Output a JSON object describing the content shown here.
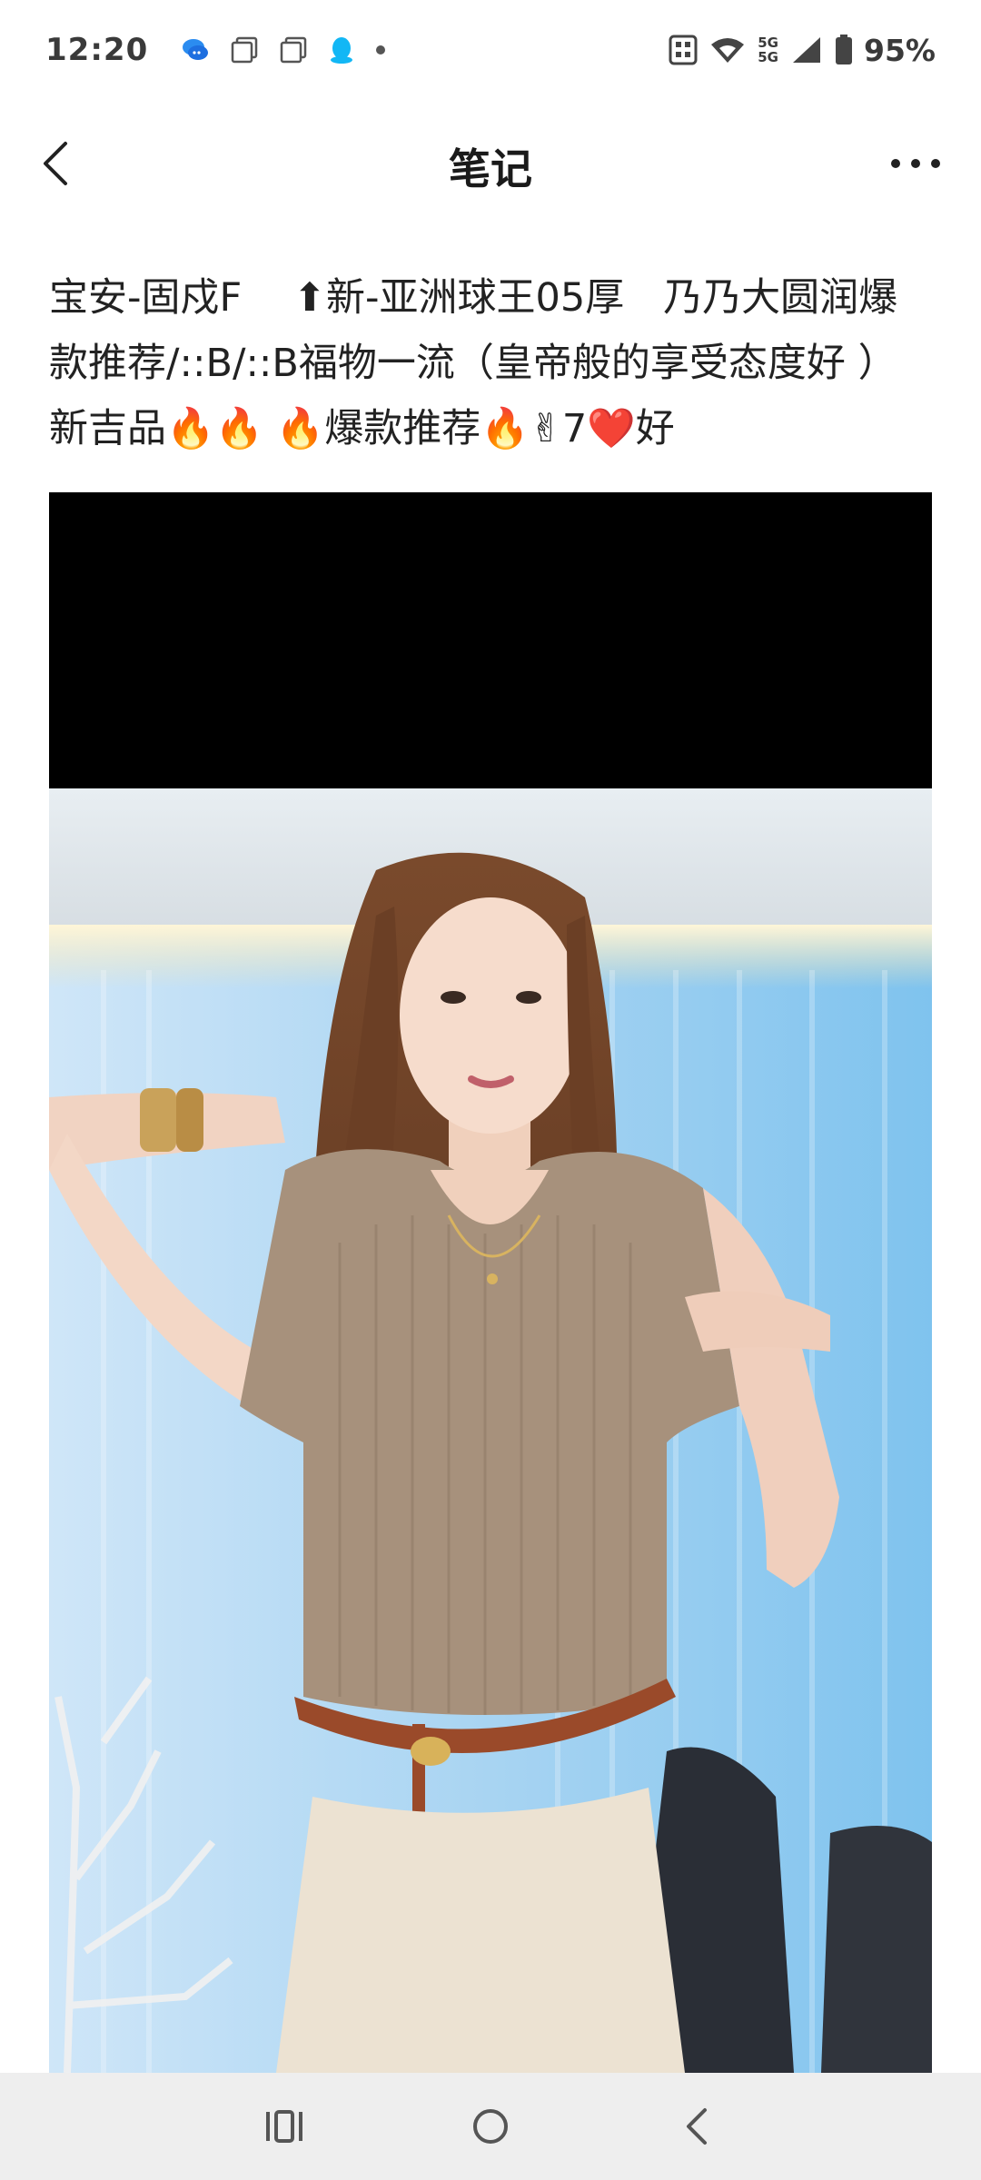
{
  "status_bar": {
    "time": "12:20",
    "battery": "95%",
    "network_top": "5G",
    "network_bottom": "5G"
  },
  "header": {
    "title": "笔记"
  },
  "note": {
    "text": "宝安-固戍F　 ⬆新-亚洲球王05厚　乃乃大圆润爆款推荐/::B/::B福物一流（皇帝般的享受态度好 ）新吉品🔥🔥 🔥爆款推荐🔥✌7❤️好"
  },
  "colors": {
    "background": "#ffffff",
    "nav_bar": "#eeeeee",
    "text": "#222222"
  },
  "icons": {
    "back": "chevron-left-icon",
    "more": "more-dots-icon",
    "nav_recents": "recents-icon",
    "nav_home": "home-circle-icon",
    "nav_back": "nav-back-icon"
  }
}
